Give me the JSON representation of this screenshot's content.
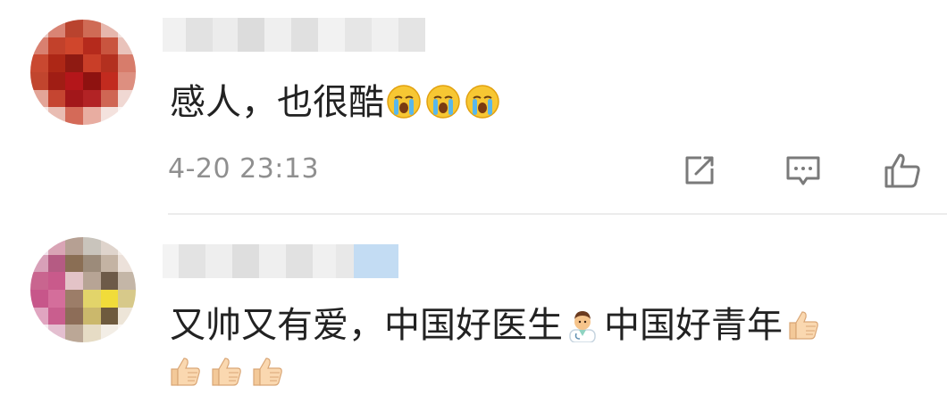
{
  "comments": [
    {
      "username_blurred": true,
      "text": "感人，也很酷",
      "emojis": [
        "loudly-crying-face",
        "loudly-crying-face",
        "loudly-crying-face"
      ],
      "timestamp": "4-20 23:13",
      "actions": {
        "share_icon": "share-icon",
        "comment_icon": "comment-icon",
        "like_icon": "thumbs-up-icon"
      }
    },
    {
      "username_blurred": true,
      "text_part1": "又帅又有爱，中国好医生",
      "emoji_doctor": "man-health-worker",
      "text_part2": "中国好青年",
      "emoji_thumbs": "thumbs-up",
      "trailing_emojis": [
        "thumbs-up",
        "thumbs-up",
        "thumbs-up"
      ]
    }
  ],
  "colors": {
    "text": "#222222",
    "timestamp": "#8f8f8f",
    "icon": "#7a7a7a",
    "divider": "#ececec"
  }
}
